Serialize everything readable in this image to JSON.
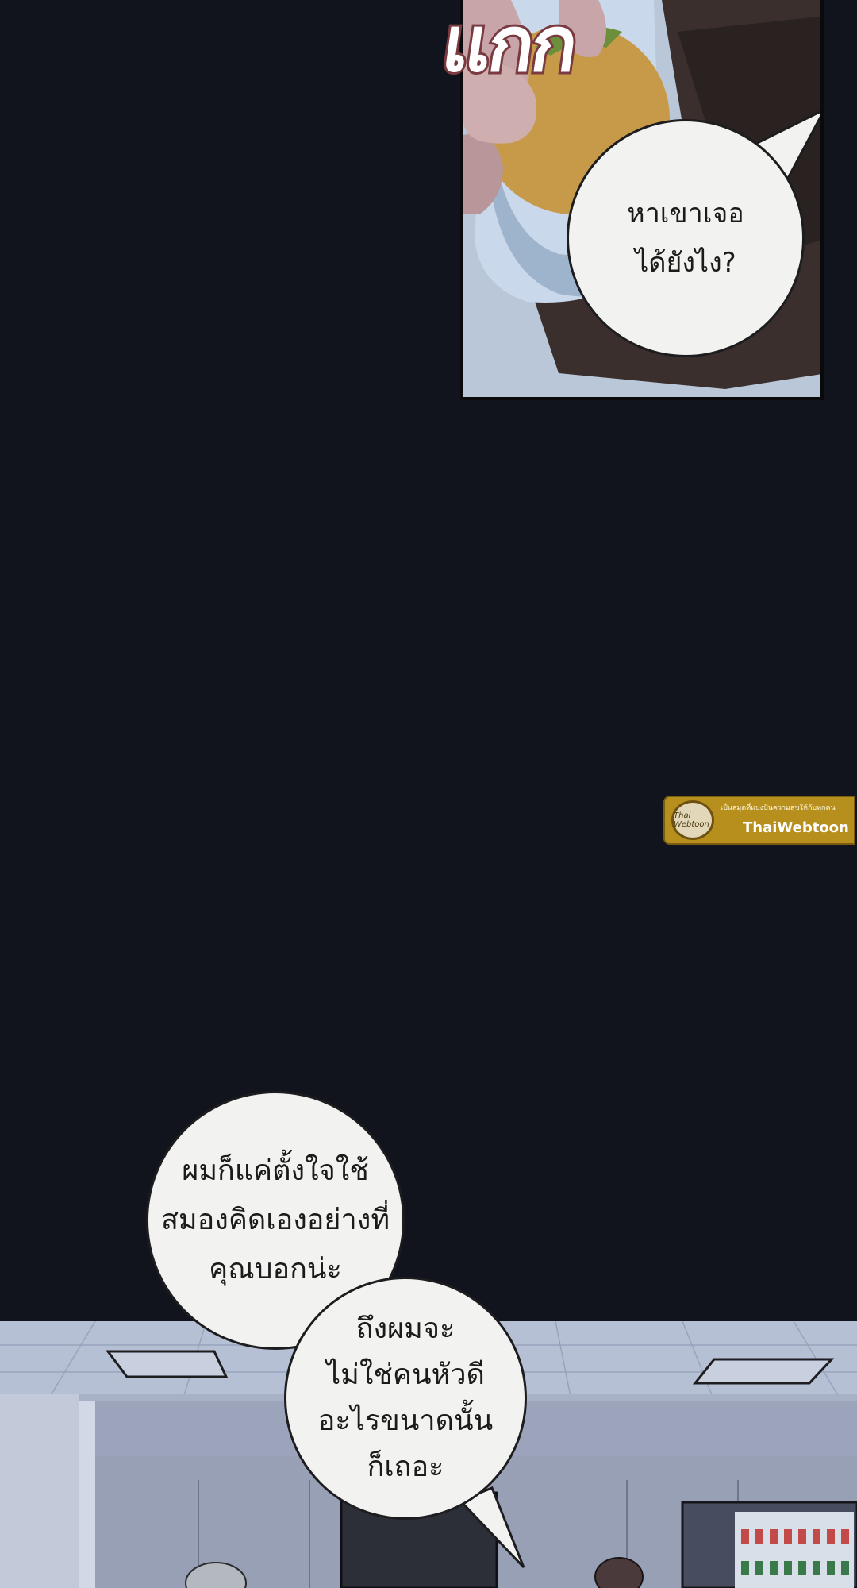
{
  "panels": {
    "top": {
      "sound_effect": "แกก",
      "speech": "หาเขาเจอ\nได้ยังไง?"
    },
    "bottom": {
      "speech_1": "ผมก็แค่ตั้งใจใช้\nสมองคิดเองอย่างที่\nคุณบอกน่ะ",
      "speech_2": "ถึงผมจะ\nไม่ใช่คนหัวดี\nอะไรขนาดนั้น\nก็เถอะ"
    }
  },
  "watermark": {
    "tagline": "เป็นสมุดที่แบ่งปันความสุขให้กับทุกคน",
    "logo_text": "Thai Webtoon",
    "name": "ThaiWebtoon"
  },
  "colors": {
    "background": "#12141d",
    "bubble_fill": "#f2f2f0",
    "sfx_stroke": "#7a3a40",
    "watermark": "#b78f1c"
  }
}
